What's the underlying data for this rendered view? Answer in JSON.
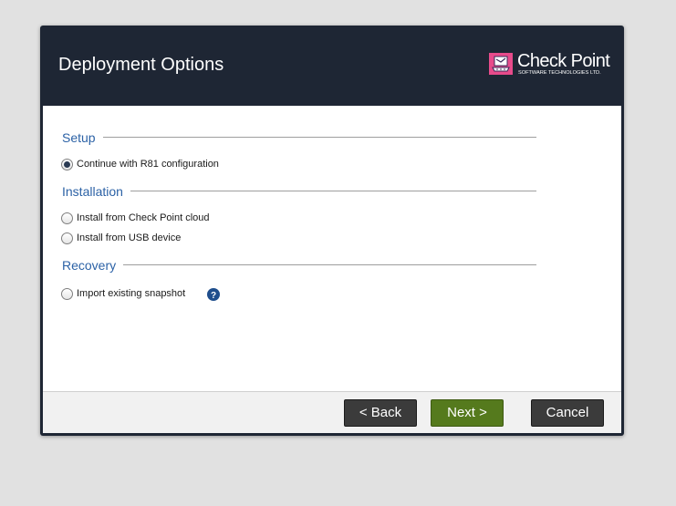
{
  "dialog": {
    "title": "Deployment Options",
    "logo": {
      "name": "Check Point",
      "tagline": "SOFTWARE TECHNOLOGIES LTD."
    }
  },
  "sections": {
    "setup": {
      "title": "Setup",
      "options": [
        {
          "label": "Continue with R81 configuration",
          "checked": true
        }
      ]
    },
    "installation": {
      "title": "Installation",
      "options": [
        {
          "label": "Install from Check Point cloud",
          "checked": false
        },
        {
          "label": "Install from USB device",
          "checked": false
        }
      ]
    },
    "recovery": {
      "title": "Recovery",
      "options": [
        {
          "label": "Import existing snapshot",
          "checked": false
        }
      ]
    }
  },
  "buttons": {
    "back": "< Back",
    "next": "Next >",
    "cancel": "Cancel"
  },
  "colors": {
    "header_bg": "#1e2634",
    "section_title": "#2c62a6",
    "next_button": "#557a1d",
    "logo_accent": "#e74b8b"
  }
}
